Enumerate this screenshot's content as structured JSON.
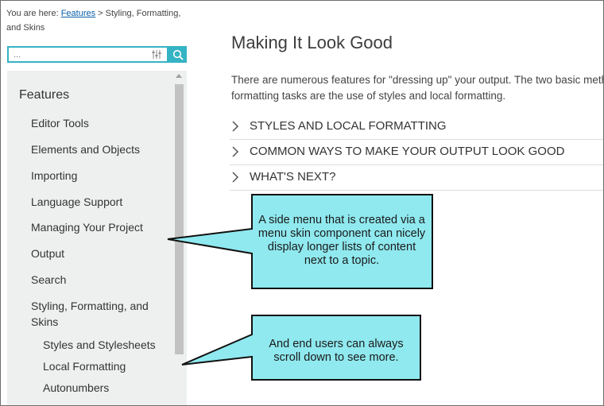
{
  "breadcrumb": {
    "prefix": "You are here: ",
    "link": "Features",
    "rest": " > Styling, Formatting, and Skins"
  },
  "search": {
    "value": "...",
    "filter_icon": "filter-sliders-icon",
    "button_icon": "search-icon"
  },
  "menu": {
    "top": "Features",
    "items": [
      "Editor Tools",
      "Elements and Objects",
      "Importing",
      "Language Support",
      "Managing Your Project",
      "Output",
      "Search",
      "Styling, Formatting, and Skins"
    ],
    "subitems": [
      "Styles and Stylesheets",
      "Local Formatting",
      "Autonumbers"
    ]
  },
  "main": {
    "title": "Making It Look Good",
    "intro": "There are numerous features for \"dressing up\" your output. The two basic methods for formatting tasks are the use of styles and local formatting.",
    "accordion": [
      "STYLES AND LOCAL FORMATTING",
      "COMMON WAYS TO MAKE YOUR OUTPUT LOOK GOOD",
      "WHAT'S NEXT?"
    ]
  },
  "callouts": {
    "one": "A side menu that is created via a menu skin component can nicely display longer lists of content next to a topic.",
    "two": "And end users can always scroll down to see more."
  },
  "colors": {
    "accent": "#34b3c4",
    "callout_fill": "#8fe9ef",
    "menu_bg": "#eef0f0"
  }
}
